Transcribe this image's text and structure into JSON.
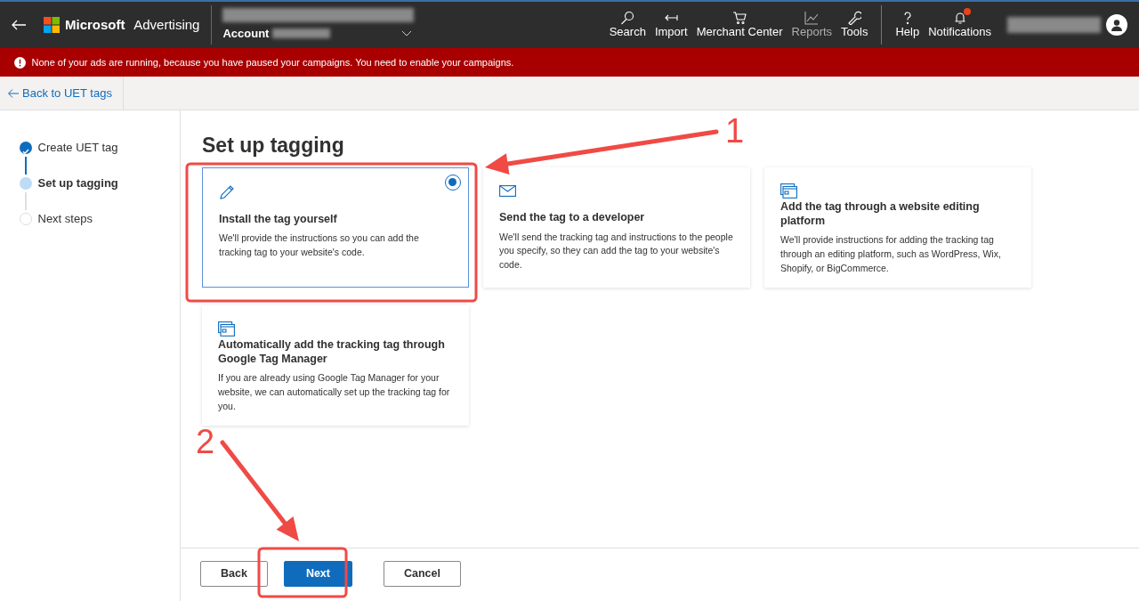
{
  "header": {
    "brand": "Microsoft",
    "product": "Advertising",
    "account_label": "Account",
    "nav": [
      {
        "label": "Search",
        "disabled": false,
        "alert": false
      },
      {
        "label": "Import",
        "disabled": false,
        "alert": false
      },
      {
        "label": "Merchant Center",
        "disabled": false,
        "alert": false
      },
      {
        "label": "Reports",
        "disabled": true,
        "alert": false
      },
      {
        "label": "Tools",
        "disabled": false,
        "alert": false
      },
      {
        "label": "Help",
        "disabled": false,
        "alert": false
      },
      {
        "label": "Notifications",
        "disabled": false,
        "alert": true
      }
    ]
  },
  "banner": {
    "message": "None of your ads are running, because you have paused your campaigns. You need to enable your campaigns."
  },
  "back_link": "Back to UET tags",
  "steps": [
    {
      "label": "Create UET tag",
      "completed": true,
      "selected": false
    },
    {
      "label": "Set up tagging",
      "completed": false,
      "selected": true
    },
    {
      "label": "Next steps",
      "completed": false,
      "selected": false
    }
  ],
  "title": "Set up tagging",
  "options": [
    {
      "title": "Install the tag yourself",
      "description": "We'll provide the instructions so you can add the tracking tag to your website's code.",
      "selected": true
    },
    {
      "title": "Send the tag to a developer",
      "description": "We'll send the tracking tag and instructions to the people you specify, so they can add the tag to your website's code.",
      "selected": false
    },
    {
      "title": "Add the tag through a website editing platform",
      "description": "We'll provide instructions for adding the tracking tag through an editing platform, such as WordPress, Wix, Shopify, or BigCommerce.",
      "selected": false
    },
    {
      "title": "Automatically add the tracking tag through Google Tag Manager",
      "description": "If you are already using Google Tag Manager for your website, we can automatically set up the tracking tag for you.",
      "selected": false
    }
  ],
  "buttons": [
    {
      "label": "Back",
      "kind": "secondary"
    },
    {
      "label": "Next",
      "kind": "primary"
    },
    {
      "label": "Cancel",
      "kind": "secondary"
    }
  ],
  "annotations": [
    {
      "label": "1"
    },
    {
      "label": "2"
    }
  ]
}
